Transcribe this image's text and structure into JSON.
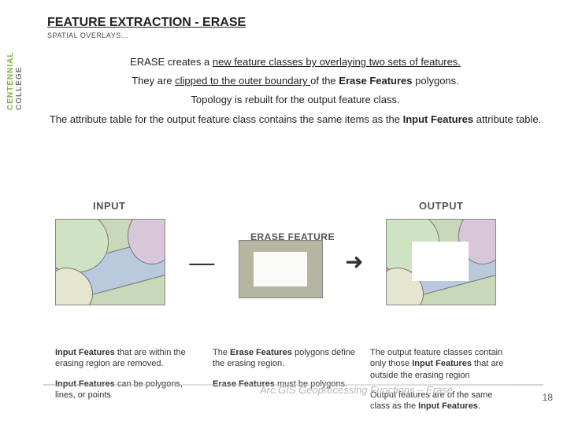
{
  "logo": {
    "green": "CENTENNIAL",
    "grey": "COLLEGE"
  },
  "header": {
    "title": "FEATURE EXTRACTION - ERASE",
    "subtitle": "SPATIAL OVERLAYS..."
  },
  "body": {
    "l1_a": "ERASE creates a ",
    "l1_b": "new feature classes by overlaying two sets of features.",
    "l2_a": "They are ",
    "l2_b": "clipped to the outer boundary ",
    "l2_c": "of the ",
    "l2_d": "Erase Features",
    "l2_e": " polygons.",
    "l3": "Topology is rebuilt for the output feature class.",
    "l4_a": "The attribute table for the output feature class contains the same items as the ",
    "l4_b": "Input Features",
    "l4_c": " attribute table."
  },
  "diagram": {
    "input": "INPUT",
    "erase": "ERASE FEATURE",
    "output": "OUTPUT",
    "minus": "—",
    "arrow": "➜"
  },
  "captions": {
    "c1a_pre": "Input Features",
    "c1a_post": " that are within the erasing region are removed.",
    "c1b_pre": "Input Features",
    "c1b_post": " can be polygons, lines, or points",
    "c2a_pre": "The ",
    "c2a_b": "Erase Features",
    "c2a_post": " polygons define the erasing region.",
    "c2b_pre": " ",
    "c2b_b": "Erase Features",
    "c2b_post": " must be polygons.",
    "c3a": "The output feature classes contain only those ",
    "c3a_b": "Input Features",
    "c3a_post": " that are outside the erasing region",
    "c3b": "Output features are of the same class as the ",
    "c3b_b": "Input Features",
    "c3b_post": "."
  },
  "watermark": "Arc.GIS Geoprocessing Functions – Erase",
  "pagenum": "18"
}
